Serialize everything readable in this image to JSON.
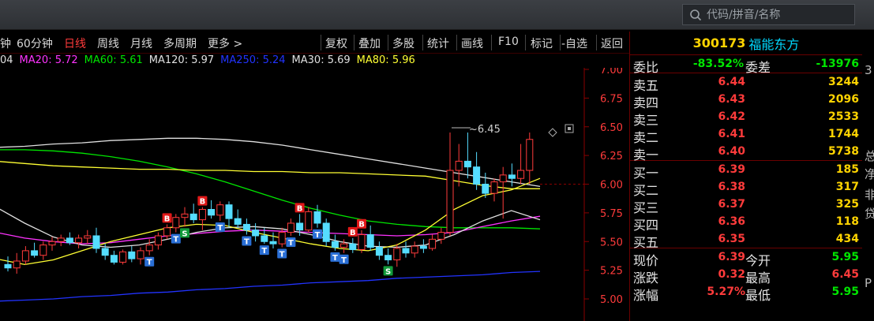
{
  "search": {
    "placeholder": "代码/拼音/名称",
    "icon": "search-icon"
  },
  "toolbar": {
    "left_partial": "钟",
    "items": [
      "60分钟",
      "日线",
      "周线",
      "月线",
      "多周期",
      "更多 >"
    ],
    "active": "日线",
    "buttons": [
      "复权",
      "叠加",
      "多股",
      "统计",
      "画线",
      "F10",
      "标记",
      "-自选",
      "返回"
    ]
  },
  "ma_legend": [
    {
      "label": "04",
      "color": "#e0e0e0"
    },
    {
      "label": "MA20: 5.72",
      "color": "#ff33ff"
    },
    {
      "label": "MA60: 5.61",
      "color": "#00e600"
    },
    {
      "label": "MA120: 5.97",
      "color": "#e0e0e0"
    },
    {
      "label": "MA250: 5.24",
      "color": "#2233ff"
    },
    {
      "label": "MA30: 5.69",
      "color": "#e0e0e0"
    },
    {
      "label": "MA80: 5.96",
      "color": "#ffff33"
    }
  ],
  "chart_data": {
    "type": "candlestick",
    "y_ticks": [
      "7.00",
      "6.75",
      "6.50",
      "6.25",
      "6.00",
      "5.75",
      "5.50",
      "5.25",
      "5.00"
    ],
    "ylim": [
      4.93,
      7.12
    ],
    "annotation": "6.45",
    "up_color": "#ff3b3b",
    "down_color": "#55ddff",
    "candles": [
      [
        5.3,
        5.37,
        5.24,
        5.27
      ],
      [
        5.27,
        5.4,
        5.22,
        5.33
      ],
      [
        5.33,
        5.46,
        5.3,
        5.42
      ],
      [
        5.42,
        5.49,
        5.36,
        5.38
      ],
      [
        5.38,
        5.5,
        5.34,
        5.47
      ],
      [
        5.47,
        5.54,
        5.42,
        5.5
      ],
      [
        5.5,
        5.56,
        5.46,
        5.53
      ],
      [
        5.53,
        5.58,
        5.47,
        5.49
      ],
      [
        5.49,
        5.56,
        5.44,
        5.53
      ],
      [
        5.53,
        5.6,
        5.48,
        5.55
      ],
      [
        5.55,
        5.62,
        5.4,
        5.44
      ],
      [
        5.44,
        5.48,
        5.34,
        5.38
      ],
      [
        5.38,
        5.42,
        5.3,
        5.32
      ],
      [
        5.32,
        5.43,
        5.3,
        5.41
      ],
      [
        5.41,
        5.46,
        5.32,
        5.35
      ],
      [
        5.35,
        5.45,
        5.3,
        5.42
      ],
      [
        5.42,
        5.52,
        5.38,
        5.47
      ],
      [
        5.47,
        5.58,
        5.43,
        5.55
      ],
      [
        5.55,
        5.65,
        5.52,
        5.62
      ],
      [
        5.62,
        5.74,
        5.58,
        5.71
      ],
      [
        5.71,
        5.8,
        5.63,
        5.74
      ],
      [
        5.74,
        5.83,
        5.66,
        5.69
      ],
      [
        5.69,
        5.8,
        5.6,
        5.78
      ],
      [
        5.78,
        5.86,
        5.7,
        5.73
      ],
      [
        5.73,
        5.85,
        5.68,
        5.82
      ],
      [
        5.82,
        5.85,
        5.62,
        5.7
      ],
      [
        5.7,
        5.78,
        5.62,
        5.65
      ],
      [
        5.65,
        5.7,
        5.56,
        5.6
      ],
      [
        5.6,
        5.66,
        5.5,
        5.55
      ],
      [
        5.55,
        5.62,
        5.48,
        5.5
      ],
      [
        5.5,
        5.58,
        5.44,
        5.48
      ],
      [
        5.48,
        5.62,
        5.45,
        5.58
      ],
      [
        5.58,
        5.7,
        5.55,
        5.66
      ],
      [
        5.66,
        5.74,
        5.55,
        5.6
      ],
      [
        5.6,
        5.8,
        5.58,
        5.76
      ],
      [
        5.76,
        5.82,
        5.62,
        5.66
      ],
      [
        5.66,
        5.7,
        5.46,
        5.5
      ],
      [
        5.5,
        5.56,
        5.42,
        5.45
      ],
      [
        5.45,
        5.52,
        5.4,
        5.48
      ],
      [
        5.48,
        5.53,
        5.4,
        5.43
      ],
      [
        5.43,
        5.6,
        5.4,
        5.56
      ],
      [
        5.56,
        5.64,
        5.42,
        5.45
      ],
      [
        5.45,
        5.5,
        5.34,
        5.38
      ],
      [
        5.38,
        5.44,
        5.3,
        5.34
      ],
      [
        5.34,
        5.48,
        5.28,
        5.44
      ],
      [
        5.44,
        5.5,
        5.36,
        5.4
      ],
      [
        5.4,
        5.5,
        5.36,
        5.46
      ],
      [
        5.46,
        5.52,
        5.4,
        5.44
      ],
      [
        5.44,
        5.56,
        5.42,
        5.52
      ],
      [
        5.52,
        5.62,
        5.48,
        5.58
      ],
      [
        5.58,
        6.45,
        5.55,
        6.12
      ],
      [
        6.12,
        6.35,
        5.98,
        6.2
      ],
      [
        6.2,
        6.45,
        6.05,
        6.15
      ],
      [
        6.15,
        6.28,
        5.95,
        6.0
      ],
      [
        6.0,
        6.1,
        5.88,
        5.92
      ],
      [
        5.92,
        6.05,
        5.85,
        6.02
      ],
      [
        6.02,
        6.15,
        5.7,
        6.08
      ],
      [
        6.08,
        6.18,
        5.98,
        6.05
      ],
      [
        6.05,
        6.35,
        6.0,
        6.12
      ],
      [
        6.12,
        6.45,
        6.0,
        6.39
      ]
    ],
    "ma_lines": [
      {
        "name": "MA120",
        "color": "#e0e0e0",
        "points": [
          6.32,
          6.33,
          6.35,
          6.36,
          6.38,
          6.39,
          6.4,
          6.4,
          6.39,
          6.37,
          6.34,
          6.3,
          6.26,
          6.22,
          6.18,
          6.14,
          6.1,
          6.06,
          6.02,
          5.98
        ]
      },
      {
        "name": "MA250",
        "color": "#2233ff",
        "points": [
          4.98,
          4.99,
          5.0,
          5.02,
          5.03,
          5.05,
          5.06,
          5.08,
          5.09,
          5.11,
          5.12,
          5.14,
          5.15,
          5.16,
          5.18,
          5.19,
          5.2,
          5.21,
          5.23,
          5.24
        ]
      },
      {
        "name": "MA60",
        "color": "#00e600",
        "points": [
          6.3,
          6.3,
          6.29,
          6.27,
          6.24,
          6.2,
          6.15,
          6.09,
          6.02,
          5.94,
          5.86,
          5.79,
          5.73,
          5.68,
          5.65,
          5.63,
          5.62,
          5.62,
          5.62,
          5.61
        ]
      },
      {
        "name": "MA80",
        "color": "#ffff33",
        "points": [
          6.2,
          6.18,
          6.16,
          6.15,
          6.14,
          6.13,
          6.13,
          6.12,
          6.12,
          6.11,
          6.11,
          6.1,
          6.1,
          6.09,
          6.08,
          6.07,
          6.03,
          5.99,
          5.96,
          5.96
        ]
      },
      {
        "name": "MA20",
        "color": "#ff33ff",
        "points": [
          5.58,
          5.53,
          5.5,
          5.48,
          5.49,
          5.52,
          5.55,
          5.57,
          5.59,
          5.6,
          5.59,
          5.58,
          5.57,
          5.56,
          5.55,
          5.56,
          5.58,
          5.63,
          5.68,
          5.72
        ]
      },
      {
        "name": "MA30",
        "color": "#e0e0e0",
        "points": [
          5.8,
          5.66,
          5.54,
          5.47,
          5.45,
          5.47,
          5.52,
          5.58,
          5.62,
          5.63,
          5.61,
          5.56,
          5.5,
          5.46,
          5.45,
          5.47,
          5.56,
          5.68,
          5.77,
          5.69
        ]
      },
      {
        "name": "MA10",
        "color": "#ffff33",
        "points": [
          5.35,
          5.3,
          5.34,
          5.42,
          5.5,
          5.56,
          5.62,
          5.65,
          5.64,
          5.58,
          5.53,
          5.48,
          5.44,
          5.42,
          5.47,
          5.6,
          5.78,
          5.9,
          5.95,
          6.05
        ]
      }
    ],
    "markers": [
      {
        "i": 16,
        "label": "T",
        "color": "#2a6fd6"
      },
      {
        "i": 18,
        "label": "B",
        "color": "#e01818"
      },
      {
        "i": 19,
        "label": "T",
        "color": "#2a6fd6"
      },
      {
        "i": 20,
        "label": "S",
        "color": "#119a3a"
      },
      {
        "i": 22,
        "label": "B",
        "color": "#e01818"
      },
      {
        "i": 24,
        "label": "T",
        "color": "#2a6fd6"
      },
      {
        "i": 27,
        "label": "T",
        "color": "#2a6fd6"
      },
      {
        "i": 29,
        "label": "T",
        "color": "#2a6fd6"
      },
      {
        "i": 31,
        "label": "T",
        "color": "#2a6fd6"
      },
      {
        "i": 32,
        "label": "T",
        "color": "#2a6fd6"
      },
      {
        "i": 33,
        "label": "B",
        "color": "#e01818"
      },
      {
        "i": 35,
        "label": "T",
        "color": "#2a6fd6"
      },
      {
        "i": 37,
        "label": "T",
        "color": "#2a6fd6"
      },
      {
        "i": 38,
        "label": "T",
        "color": "#2a6fd6"
      },
      {
        "i": 39,
        "label": "B",
        "color": "#e01818"
      },
      {
        "i": 40,
        "label": "B",
        "color": "#e01818"
      },
      {
        "i": 43,
        "label": "S",
        "color": "#119a3a"
      }
    ]
  },
  "panel": {
    "code": "300173",
    "name": "福能东方",
    "weibi_label": "委比",
    "weibi_value": "-83.52%",
    "weicha_label": "委差",
    "weicha_value": "-13976",
    "asks": [
      {
        "label": "卖五",
        "price": "6.44",
        "vol": "3244"
      },
      {
        "label": "卖四",
        "price": "6.43",
        "vol": "2096"
      },
      {
        "label": "卖三",
        "price": "6.42",
        "vol": "2533"
      },
      {
        "label": "卖二",
        "price": "6.41",
        "vol": "1744"
      },
      {
        "label": "卖一",
        "price": "6.40",
        "vol": "5738"
      }
    ],
    "bids": [
      {
        "label": "买一",
        "price": "6.39",
        "vol": "185"
      },
      {
        "label": "买二",
        "price": "6.38",
        "vol": "317"
      },
      {
        "label": "买三",
        "price": "6.37",
        "vol": "325"
      },
      {
        "label": "买四",
        "price": "6.36",
        "vol": "118"
      },
      {
        "label": "买五",
        "price": "6.35",
        "vol": "434"
      }
    ],
    "quote": [
      {
        "l1": "现价",
        "v1": "6.39",
        "l2": "今开",
        "v2": "5.95",
        "c2": "#00e600"
      },
      {
        "l1": "涨跌",
        "v1": "0.32",
        "l2": "最高",
        "v2": "6.45",
        "c2": "#ff3b3b"
      },
      {
        "l1": "涨幅",
        "v1": "5.27%",
        "l2": "最低",
        "v2": "5.95",
        "c2": "#00e600"
      }
    ]
  },
  "edge_chars": [
    "3",
    "总",
    "净",
    "非",
    "贷",
    "P"
  ]
}
